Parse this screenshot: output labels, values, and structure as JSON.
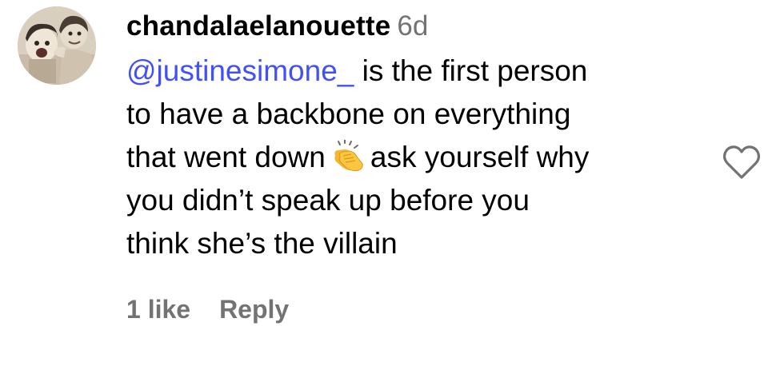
{
  "comment": {
    "username": "chandalaelanouette",
    "timestamp": "6d",
    "mention": "@justinesimone_",
    "text_lines": [
      " is the first person",
      "to have a backbone on everything",
      "that went down",
      "ask yourself why",
      "you didn’t speak up before you",
      "think she’s the villain"
    ],
    "emoji": "clapping-hands-icon",
    "likes_label": "1 like",
    "reply_label": "Reply"
  },
  "colors": {
    "mention": "#4150f7",
    "secondary_text": "#737373",
    "primary_text": "#000000",
    "heart_outline": "#737373"
  }
}
